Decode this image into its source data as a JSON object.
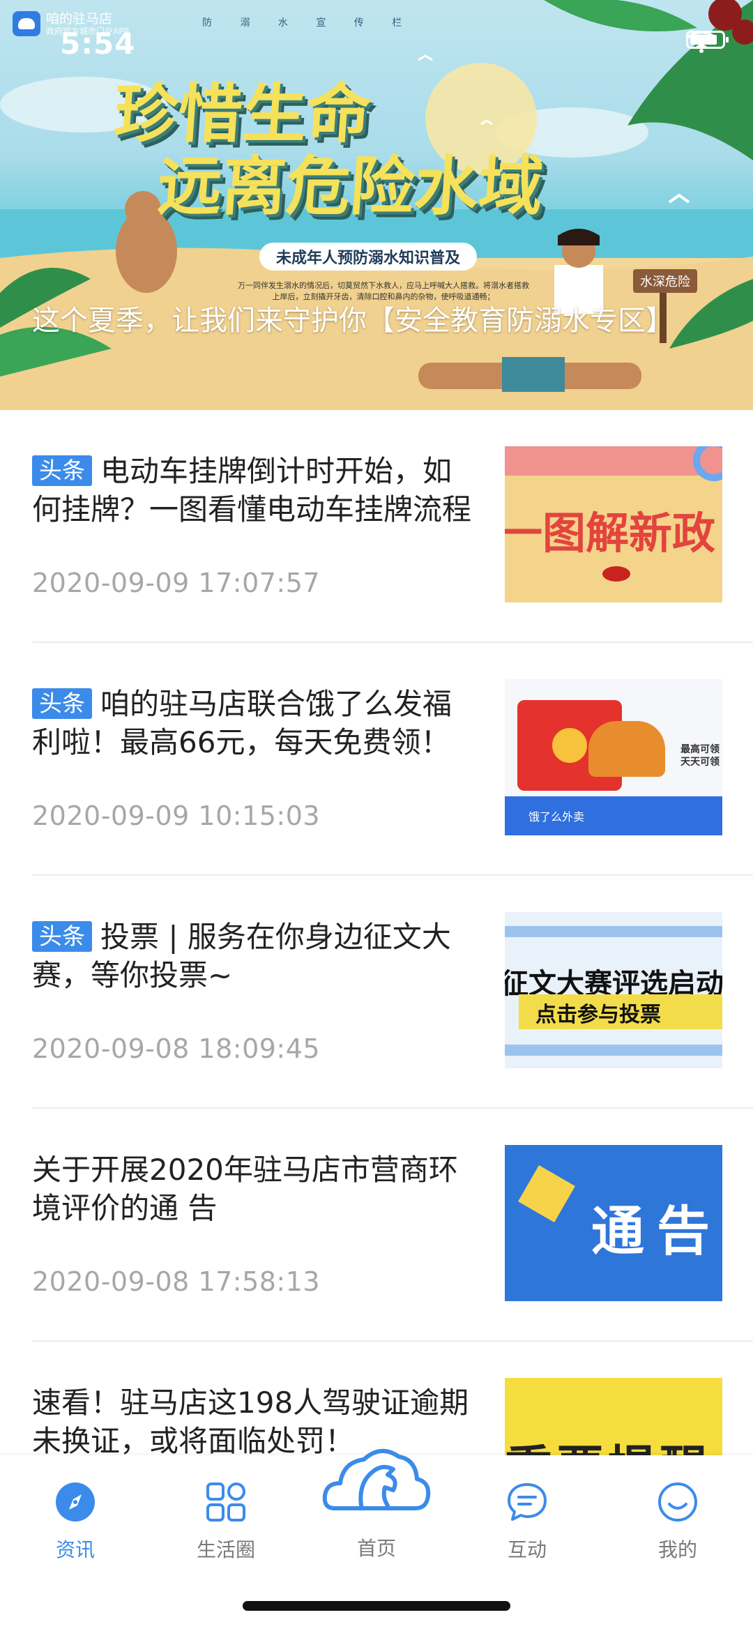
{
  "status_bar": {
    "time": "5:54",
    "app_name": "咱的驻马店",
    "app_subtitle": "政府官方城市门户APP"
  },
  "banner": {
    "poster_top": "防 溺 水 宣 传 栏",
    "poster_title_line1": "珍惜生命",
    "poster_title_line2": "远离危险水域",
    "poster_subtitle": "未成年人预防溺水知识普及",
    "poster_note": "万一同伴发生溺水的情况后，切莫贸然下水救人，应马上呼喊大人搭救。将溺水者搭救上岸后，立刻撬开牙齿，清除口腔和鼻内的杂物，使呼吸道通畅；",
    "poster_sign": "水深危险",
    "caption": "这个夏季，让我们来守护你【安全教育防溺水专区】"
  },
  "news": [
    {
      "tag": "头条",
      "title": "电动车挂牌倒计时开始，如何挂牌？一图看懂电动车挂牌流程",
      "date": "2020-09-09 17:07:57",
      "thumb_text": "一图解新政"
    },
    {
      "tag": "头条",
      "title": "咱的驻马店联合饿了么发福利啦！最高66元，每天免费领！",
      "date": "2020-09-09 10:15:03",
      "thumb_text": "饿了么外卖",
      "thumb_side": "最高可领\n天天可领"
    },
    {
      "tag": "头条",
      "title": "投票 | 服务在你身边征文大赛，等你投票~",
      "date": "2020-09-08 18:09:45",
      "thumb_text": "征文大赛评选启动",
      "thumb_sub": "点击参与投票"
    },
    {
      "tag": "",
      "title": "关于开展2020年驻马店市营商环境评价的通 告",
      "date": "2020-09-08 17:58:13",
      "thumb_text": "通告"
    },
    {
      "tag": "",
      "title": "速看！驻马店这198人驾驶证逾期未换证，或将面临处罚！",
      "date": "",
      "thumb_text": "重要提醒"
    }
  ],
  "tabbar": {
    "tabs": [
      {
        "label": "资讯",
        "icon": "compass-icon",
        "active": true
      },
      {
        "label": "生活圈",
        "icon": "grid-icon",
        "active": false
      },
      {
        "label": "首页",
        "icon": "horse-cloud-icon",
        "active": false
      },
      {
        "label": "互动",
        "icon": "chat-icon",
        "active": false
      },
      {
        "label": "我的",
        "icon": "smile-icon",
        "active": false
      }
    ]
  },
  "colors": {
    "accent": "#3b8bea",
    "date_gray": "#a7a7a7",
    "tab_inactive": "#7a7a7a"
  }
}
